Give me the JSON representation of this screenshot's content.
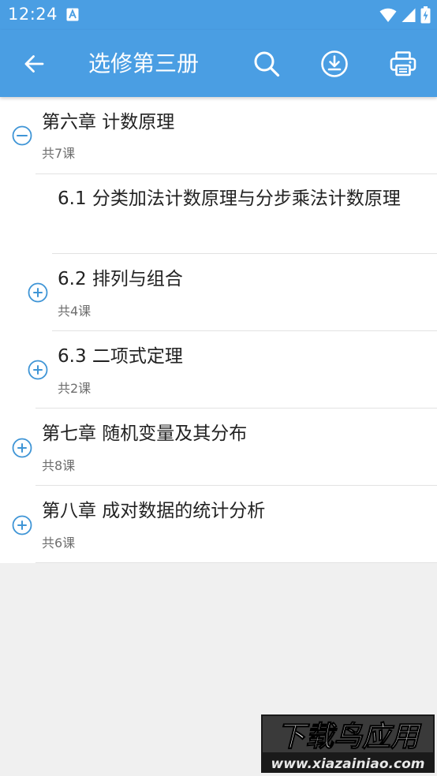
{
  "status_bar": {
    "time": "12:24",
    "app_icon": "a-letter-icon",
    "icons": [
      "wifi-icon",
      "cellular-icon",
      "battery-charging-icon"
    ]
  },
  "app_bar": {
    "title": "选修第三册",
    "back_icon": "arrow-left-icon",
    "actions": [
      {
        "name": "search",
        "icon": "search-icon"
      },
      {
        "name": "download",
        "icon": "download-icon"
      },
      {
        "name": "print",
        "icon": "printer-icon"
      }
    ]
  },
  "chapters": [
    {
      "title": "第六章 计数原理",
      "sub": "共7课",
      "expanded": true,
      "sections": [
        {
          "title": "6.1 分类加法计数原理与分步乘法计数原理",
          "sub": "",
          "expandable": false
        },
        {
          "title": "6.2 排列与组合",
          "sub": "共4课",
          "expandable": true
        },
        {
          "title": "6.3 二项式定理",
          "sub": "共2课",
          "expandable": true
        }
      ]
    },
    {
      "title": "第七章 随机变量及其分布",
      "sub": "共8课",
      "expanded": false
    },
    {
      "title": "第八章 成对数据的统计分析",
      "sub": "共6课",
      "expanded": false
    }
  ],
  "watermark": {
    "brand": "下载鸟应用",
    "url": "www.xiazainiao.com"
  },
  "colors": {
    "primary": "#4a9ee3",
    "icon_blue": "#3f95d6",
    "text": "#222222",
    "subtext": "#6e6e6e",
    "divider": "#e2e2e2",
    "background": "#f0f0f0"
  }
}
